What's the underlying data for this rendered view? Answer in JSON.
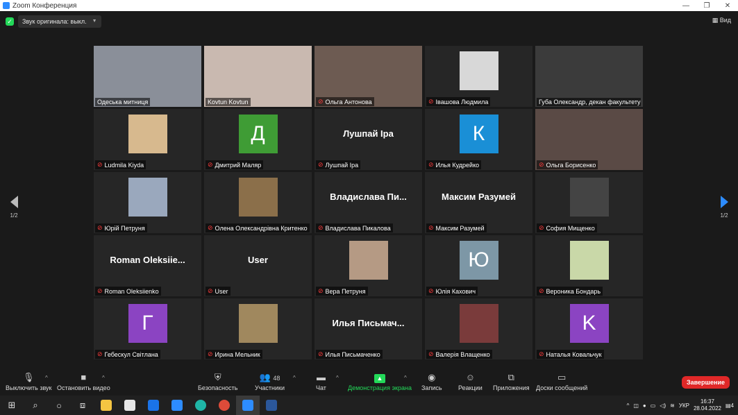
{
  "window": {
    "title": "Zoom Конференция",
    "controls": [
      "—",
      "❐",
      "✕"
    ]
  },
  "topbar": {
    "original_sound": "Звук оригинала: выкл.",
    "view_label": "Вид"
  },
  "pagination": {
    "left": "1/2",
    "right": "1/2"
  },
  "participants": [
    {
      "name": "Одеська митниця",
      "type": "video",
      "mic_off": false,
      "bg": "#8a8f99"
    },
    {
      "name": "Kovtun Kovtun",
      "type": "video",
      "mic_off": false,
      "bg": "#c9b9b0"
    },
    {
      "name": "Ольга Антонова",
      "type": "video",
      "mic_off": true,
      "bg": "#6d5b52"
    },
    {
      "name": "Івашова Людмила",
      "type": "photo",
      "mic_off": true,
      "bg": "#d8d8d8"
    },
    {
      "name": "Губа Олександр, декан факультету у...",
      "type": "video",
      "mic_off": false,
      "bg": "#3b3b3b",
      "active": true
    },
    {
      "name": "Ludmila Kiyda",
      "type": "photo",
      "mic_off": true,
      "bg": "#d7b98e"
    },
    {
      "name": "Дмитрий Маляр",
      "type": "avatar",
      "letter": "Д",
      "color": "#3f9c35",
      "mic_off": true
    },
    {
      "name": "Лушпай Іра",
      "type": "text",
      "big": "Лушпай Іра",
      "mic_off": true
    },
    {
      "name": "Илья Кудрейко",
      "type": "avatar",
      "letter": "К",
      "color": "#1a8fd6",
      "mic_off": true
    },
    {
      "name": "Ольга Борисенко",
      "type": "video",
      "mic_off": true,
      "bg": "#5a4a45"
    },
    {
      "name": "Юрій Петруня",
      "type": "photo",
      "mic_off": true,
      "bg": "#9aa8bd"
    },
    {
      "name": "Олена Олександрівна Критенко",
      "type": "photo",
      "mic_off": true,
      "bg": "#8b6f4a"
    },
    {
      "name": "Владислава Пикалова",
      "type": "text",
      "big": "Владислава  Пи...",
      "mic_off": true
    },
    {
      "name": "Максим Разумей",
      "type": "text",
      "big": "Максим Разумей",
      "mic_off": true
    },
    {
      "name": "София Мищенко",
      "type": "photo",
      "mic_off": true,
      "bg": "#444444"
    },
    {
      "name": "Roman Oleksiienko",
      "type": "text",
      "big": "Roman  Oleksiie...",
      "mic_off": true
    },
    {
      "name": "User",
      "type": "text",
      "big": "User",
      "mic_off": true
    },
    {
      "name": "Вера Петруня",
      "type": "photo",
      "mic_off": true,
      "bg": "#b59a84"
    },
    {
      "name": "Юлія Кахович",
      "type": "avatar",
      "letter": "Ю",
      "color": "#7d97a6",
      "mic_off": true
    },
    {
      "name": "Вероника Бондарь",
      "type": "photo",
      "mic_off": true,
      "bg": "#c9d8a8"
    },
    {
      "name": "Гебескул Світлана",
      "type": "avatar",
      "letter": "Г",
      "color": "#8b44c2",
      "mic_off": true
    },
    {
      "name": "Ирина Мельник",
      "type": "photo",
      "mic_off": true,
      "bg": "#a0885e"
    },
    {
      "name": "Илья Письмаченко",
      "type": "text",
      "big": "Илья  Письмач...",
      "mic_off": true
    },
    {
      "name": "Валерія Влащенко",
      "type": "photo",
      "mic_off": true,
      "bg": "#7a3b3b"
    },
    {
      "name": "Наталья Ковальчук",
      "type": "avatar",
      "letter": "K",
      "color": "#8b44c2",
      "mic_off": true
    }
  ],
  "toolbar": {
    "mute": "Выключить звук",
    "video": "Остановить видео",
    "security": "Безопасность",
    "participants": "Участники",
    "participants_count": "48",
    "chat": "Чат",
    "share": "Демонстрация экрана",
    "record": "Запись",
    "reactions": "Реакции",
    "apps": "Приложения",
    "whiteboards": "Доски сообщений",
    "end": "Завершение"
  },
  "taskbar": {
    "lang": "УКР",
    "time": "16:37",
    "date": "28.04.2022",
    "notifications": "4"
  }
}
